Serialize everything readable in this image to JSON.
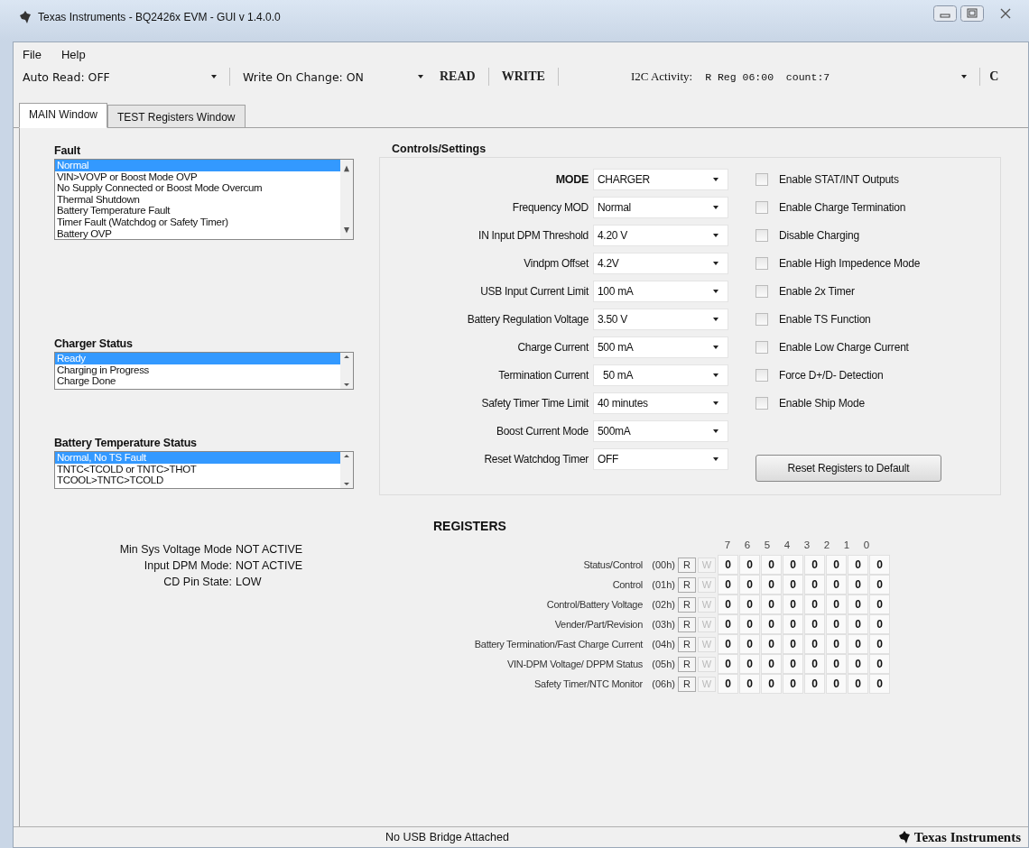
{
  "window": {
    "title": "Texas Instruments - BQ2426x EVM - GUI v 1.4.0.0"
  },
  "menu": [
    {
      "label": "File"
    },
    {
      "label": "Help"
    }
  ],
  "toolbar": {
    "auto_read": "Auto Read: OFF",
    "write_on_change": "Write On Change: ON",
    "read_button": "READ",
    "write_button": "WRITE",
    "i2c_label": "I2C Activity:",
    "i2c_value": "R Reg 06:00  count:7",
    "cut_button": "C"
  },
  "tabs": [
    {
      "label": "MAIN Window",
      "selected": true
    },
    {
      "label": "TEST Registers Window",
      "selected": false
    }
  ],
  "lists": [
    {
      "title": "Fault",
      "items": [
        {
          "label": "Normal",
          "selected": true
        },
        {
          "label": "VIN>VOVP or Boost Mode OVP",
          "selected": false
        },
        {
          "label": "No Supply Connected or  Boost Mode Overcum",
          "selected": false
        },
        {
          "label": "Thermal Shutdown",
          "selected": false
        },
        {
          "label": "Battery Temperature Fault",
          "selected": false
        },
        {
          "label": "Timer Fault (Watchdog or Safety Timer)",
          "selected": false
        },
        {
          "label": "Battery OVP",
          "selected": false
        }
      ]
    },
    {
      "title": "Charger Status",
      "items": [
        {
          "label": "Ready",
          "selected": true
        },
        {
          "label": "Charging in Progress",
          "selected": false
        },
        {
          "label": "Charge Done",
          "selected": false
        }
      ]
    },
    {
      "title": "Battery Temperature Status",
      "items": [
        {
          "label": "Normal, No TS Fault",
          "selected": true
        },
        {
          "label": "TNTC<TCOLD or TNTC>THOT",
          "selected": false
        },
        {
          "label": "TCOOL>TNTC>TCOLD",
          "selected": false
        }
      ]
    }
  ],
  "status_items": [
    {
      "label": "Min Sys Voltage Mode",
      "value": "NOT ACTIVE"
    },
    {
      "label": "Input DPM Mode:",
      "value": "NOT ACTIVE"
    },
    {
      "label": "CD Pin State:",
      "value": "LOW"
    }
  ],
  "controls": {
    "title": "Controls/Settings",
    "settings": [
      {
        "label": "MODE",
        "value": "CHARGER",
        "bold": true
      },
      {
        "label": "Frequency MOD",
        "value": "Normal",
        "bold": false
      },
      {
        "label": "IN Input DPM Threshold",
        "value": "4.20 V",
        "bold": false
      },
      {
        "label": "Vindpm Offset",
        "value": "4.2V",
        "bold": false
      },
      {
        "label": "USB Input Current Limit",
        "value": "100 mA",
        "bold": false
      },
      {
        "label": "Battery Regulation Voltage",
        "value": "3.50 V",
        "bold": false
      },
      {
        "label": "Charge Current",
        "value": "500 mA",
        "bold": false
      },
      {
        "label": "Termination Current",
        "value": "  50 mA",
        "bold": false
      },
      {
        "label": "Safety Timer Time Limit",
        "value": "40 minutes",
        "bold": false
      },
      {
        "label": "Boost Current Mode",
        "value": "500mA",
        "bold": false
      },
      {
        "label": "Reset Watchdog Timer",
        "value": "OFF",
        "bold": false
      }
    ],
    "checkboxes": [
      {
        "label": "Enable STAT/INT Outputs",
        "checked": false
      },
      {
        "label": "Enable Charge Termination",
        "checked": false
      },
      {
        "label": "Disable Charging",
        "checked": false
      },
      {
        "label": "Enable High Impedence Mode",
        "checked": false
      },
      {
        "label": "Enable 2x Timer",
        "checked": false
      },
      {
        "label": "Enable TS Function",
        "checked": false
      },
      {
        "label": "Enable Low Charge Current",
        "checked": false
      },
      {
        "label": "Force D+/D- Detection",
        "checked": false
      },
      {
        "label": "Enable Ship Mode",
        "checked": false
      }
    ],
    "reset_button": "Reset Registers to Default"
  },
  "registers": {
    "title": "REGISTERS",
    "bit_headers": [
      "7",
      "6",
      "5",
      "4",
      "3",
      "2",
      "1",
      "0"
    ],
    "rows": [
      {
        "label": "Status/Control",
        "address": "(00h)",
        "read": "R",
        "write": "W",
        "write_disabled": true,
        "bits": [
          "0",
          "0",
          "0",
          "0",
          "0",
          "0",
          "0",
          "0"
        ]
      },
      {
        "label": "Control",
        "address": "(01h)",
        "read": "R",
        "write": "W",
        "write_disabled": true,
        "bits": [
          "0",
          "0",
          "0",
          "0",
          "0",
          "0",
          "0",
          "0"
        ]
      },
      {
        "label": "Control/Battery Voltage",
        "address": "(02h)",
        "read": "R",
        "write": "W",
        "write_disabled": true,
        "bits": [
          "0",
          "0",
          "0",
          "0",
          "0",
          "0",
          "0",
          "0"
        ]
      },
      {
        "label": "Vender/Part/Revision",
        "address": "(03h)",
        "read": "R",
        "write": "W",
        "write_disabled": true,
        "bits": [
          "0",
          "0",
          "0",
          "0",
          "0",
          "0",
          "0",
          "0"
        ]
      },
      {
        "label": "Battery Termination/Fast Charge Current",
        "address": "(04h)",
        "read": "R",
        "write": "W",
        "write_disabled": true,
        "bits": [
          "0",
          "0",
          "0",
          "0",
          "0",
          "0",
          "0",
          "0"
        ]
      },
      {
        "label": "VIN-DPM Voltage/ DPPM Status",
        "address": "(05h)",
        "read": "R",
        "write": "W",
        "write_disabled": true,
        "bits": [
          "0",
          "0",
          "0",
          "0",
          "0",
          "0",
          "0",
          "0"
        ]
      },
      {
        "label": "Safety Timer/NTC Monitor",
        "address": "(06h)",
        "read": "R",
        "write": "W",
        "write_disabled": true,
        "bits": [
          "0",
          "0",
          "0",
          "0",
          "0",
          "0",
          "0",
          "0"
        ]
      }
    ]
  },
  "status_bar": {
    "message": "No USB Bridge Attached",
    "brand": "Texas Instruments"
  }
}
